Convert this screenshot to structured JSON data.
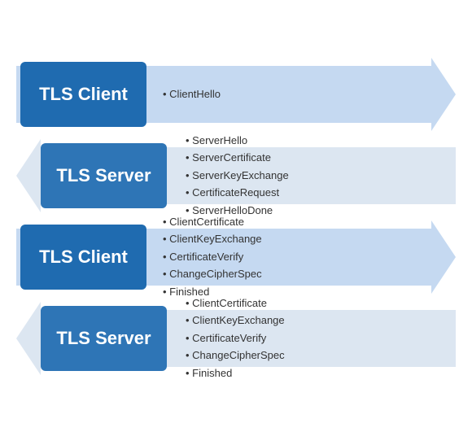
{
  "rows": [
    {
      "direction": "right",
      "label": "TLS Client",
      "bullets": [
        "ClientHello"
      ]
    },
    {
      "direction": "left",
      "label": "TLS Server",
      "bullets": [
        "ServerHello",
        "ServerCertificate",
        "ServerKeyExchange",
        "CertificateRequest",
        "ServerHelloDone"
      ]
    },
    {
      "direction": "right",
      "label": "TLS Client",
      "bullets": [
        "ClientCertificate",
        "ClientKeyExchange",
        "CertificateVerify",
        "ChangeCipherSpec",
        "Finished"
      ]
    },
    {
      "direction": "left",
      "label": "TLS Server",
      "bullets": [
        "ClientCertificate",
        "ClientKeyExchange",
        "CertificateVerify",
        "ChangeCipherSpec",
        "Finished"
      ]
    }
  ]
}
